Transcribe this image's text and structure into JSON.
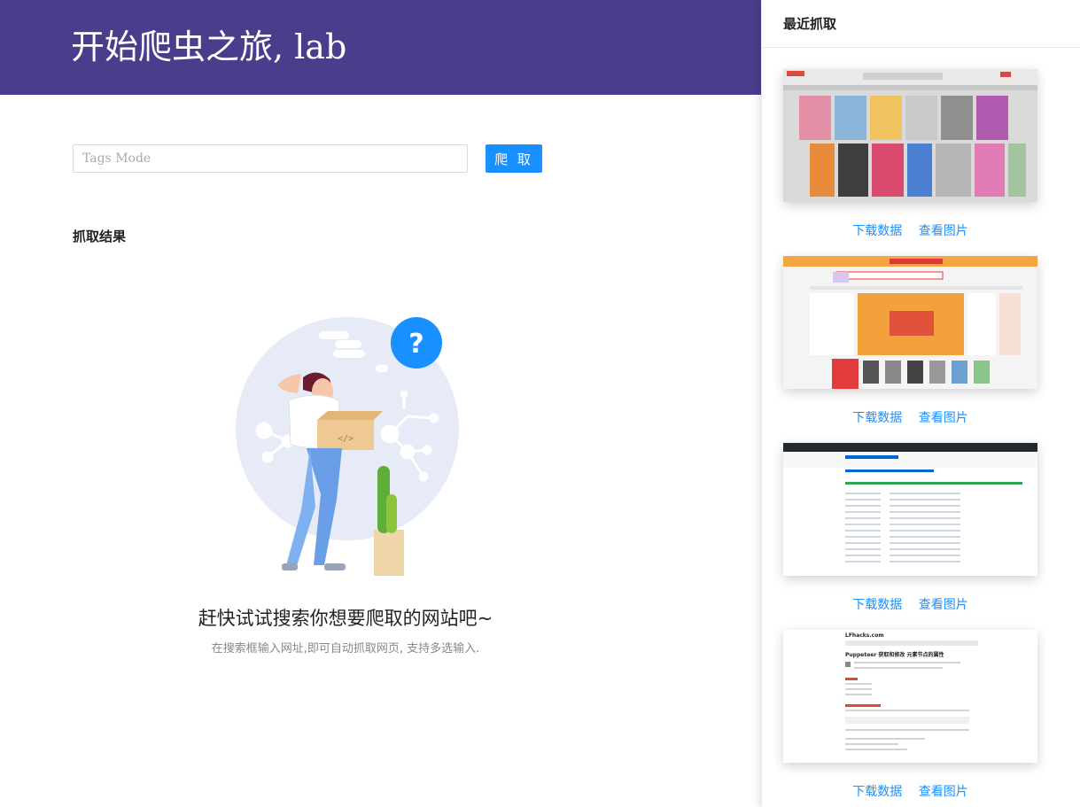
{
  "header": {
    "title": "开始爬虫之旅, lab"
  },
  "search": {
    "placeholder": "Tags Mode",
    "button_label": "爬 取"
  },
  "results": {
    "title": "抓取结果"
  },
  "empty_state": {
    "title": "赶快试试搜索你想要爬取的网站吧~",
    "description": "在搜索框输入网址,即可自动抓取网页, 支持多选输入."
  },
  "recent": {
    "title": "最近抓取",
    "items": [
      {
        "download_label": "下载数据",
        "view_label": "查看图片"
      },
      {
        "download_label": "下载数据",
        "view_label": "查看图片"
      },
      {
        "download_label": "下载数据",
        "view_label": "查看图片"
      },
      {
        "download_label": "下载数据",
        "view_label": "查看图片",
        "thumb_site": "LFhacks.com",
        "thumb_heading": "Puppeteer 获取和修改 元素节点的属性"
      }
    ]
  },
  "colors": {
    "header_bg": "#4a3d8c",
    "accent": "#1890ff"
  },
  "icons": {
    "question_badge": "question-icon"
  }
}
